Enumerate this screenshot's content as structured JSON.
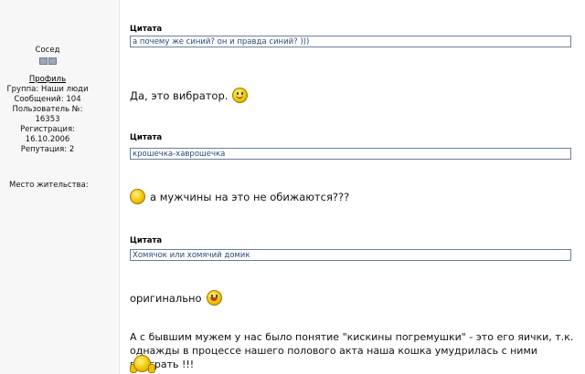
{
  "sidebar": {
    "rank": "Сосед",
    "profile_link": "Профиль",
    "group": "Группа: Наши люди",
    "posts": "Сообщений: 104",
    "user_number": "Пользователь №: 16353",
    "registration": "Регистрация: 16.10.2006",
    "reputation": "Репутация: 2",
    "residence": "Место жительства:"
  },
  "posts": [
    {
      "quote_title": "Цитата",
      "quote_text": "а почему же синий? он и правда синий? )))",
      "reply": "Да, это вибратор.",
      "smiley": "smile-icon"
    },
    {
      "quote_title": "Цитата",
      "quote_text": "крошечка-хаврошечка",
      "reply": "а мужчины на это не обижаются???",
      "smiley": "plain-smiley-icon"
    },
    {
      "quote_title": "Цитата",
      "quote_text": "Хомячок или хомячий домик",
      "reply": "оригинально",
      "smiley": "tongue-smiley-icon"
    }
  ],
  "final_text": "А с бывшим мужем у нас было понятие \"кискины погремушки\" - это его яички, т.к. однажды в процессе нашего полового акта наша кошка умудрилась с ними поиграть !!!",
  "final_smiley": "laughing-smiley-icon"
}
